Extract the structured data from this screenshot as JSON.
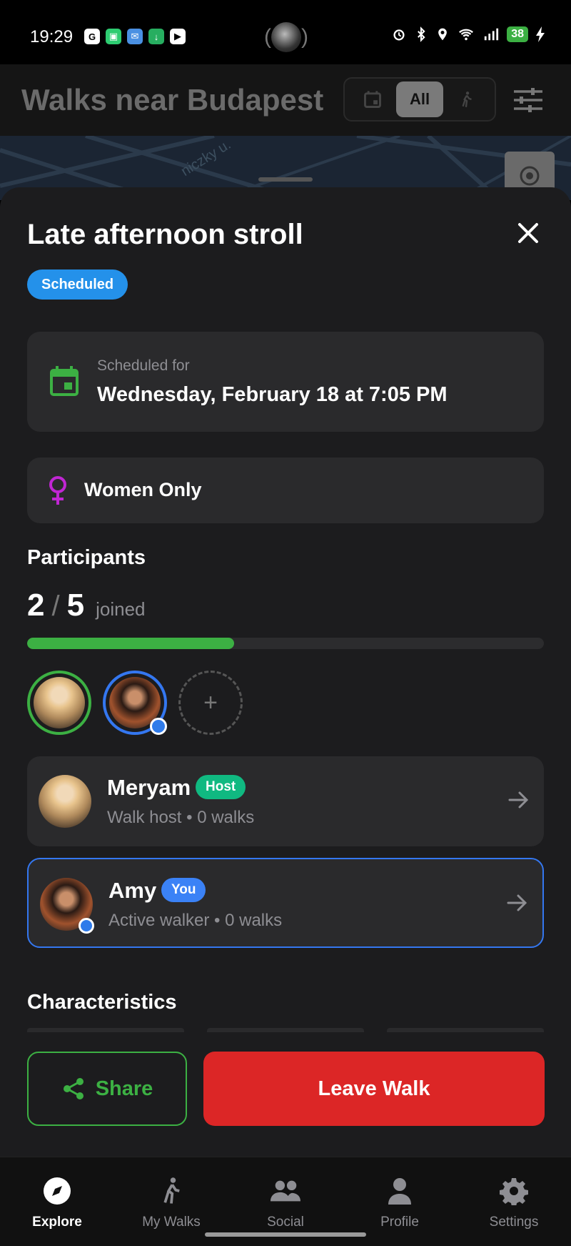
{
  "status_bar": {
    "time": "19:29",
    "battery": "38"
  },
  "header": {
    "title": "Walks near Budapest",
    "segments": [
      "calendar-icon",
      "All",
      "walking-icon"
    ],
    "active_segment": "All"
  },
  "map": {
    "street_label": "niczky u."
  },
  "walk": {
    "title": "Late afternoon stroll",
    "status": "Scheduled",
    "schedule_label": "Scheduled for",
    "schedule_value": "Wednesday, February 18 at 7:05 PM",
    "restriction": "Women Only"
  },
  "participants": {
    "title": "Participants",
    "joined": "2",
    "capacity": "5",
    "slash": "/",
    "joined_word": "joined",
    "fill_fraction": 0.4,
    "list": [
      {
        "name": "Meryam",
        "badge": "Host",
        "subtitle": "Walk host • 0 walks",
        "badge_color": "#10b981"
      },
      {
        "name": "Amy",
        "badge": "You",
        "subtitle": "Active walker • 0 walks",
        "badge_color": "#3b82f6"
      }
    ]
  },
  "characteristics": {
    "title": "Characteristics"
  },
  "actions": {
    "share": "Share",
    "leave": "Leave Walk"
  },
  "nav": [
    "Explore",
    "My Walks",
    "Social",
    "Profile",
    "Settings"
  ],
  "colors": {
    "accent_green": "#3cb043",
    "danger_red": "#dc2626",
    "scheduled_blue": "#2491ea",
    "women_purple": "#c026d3"
  }
}
